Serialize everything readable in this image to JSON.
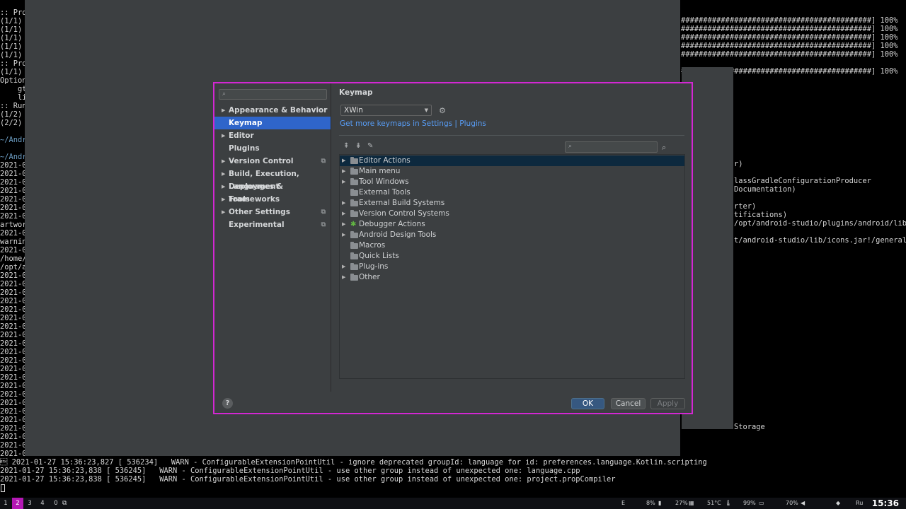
{
  "terminal_left": {
    "lines": [
      ":: Pro",
      "(1/1)",
      "(1/1)",
      "(1/1)",
      "(1/1)",
      "(1/1)",
      ":: Pro",
      "(1/1)",
      "Option",
      "    gt",
      "    li",
      ":: Run",
      "(1/2)",
      "(2/2)",
      "",
      "~/Andr",
      "",
      "~/Andr",
      "2021-0",
      "2021-0",
      "2021-0",
      "2021-0",
      "2021-0",
      "2021-0",
      "2021-0",
      "artwor",
      "2021-0",
      "warnin",
      "2021-0",
      "/home/",
      "/opt/a",
      "2021-0",
      "2021-0",
      "2021-0",
      "2021-0",
      "2021-0",
      "2021-0",
      "2021-0",
      "2021-0",
      "2021-0",
      "2021-0",
      "2021-0",
      "2021-0",
      "2021-0",
      "2021-0",
      "2021-0",
      "2021-0",
      "2021-0",
      "2021-0",
      "2021-0",
      "2021-0",
      "2021-0",
      "2021-0"
    ]
  },
  "terminal_right": {
    "lines": [
      "###########################################] 100%",
      "###########################################] 100%",
      "###########################################] 100%",
      "###########################################] 100%",
      "###########################################] 100%",
      "",
      "###########################################] 100%"
    ]
  },
  "terminal_right2": {
    "lines": [
      "r)",
      "",
      "lassGradleConfigurationProducer",
      "Documentation)",
      "",
      "rter)",
      "tifications)",
      "/opt/android-studio/plugins/android/lib/",
      "",
      "t/android-studio/lib/icons.jar!/general/",
      "",
      "",
      "",
      "",
      "",
      "",
      "",
      "",
      "",
      "",
      "",
      "",
      "",
      "",
      "",
      "",
      "",
      "",
      "",
      "",
      "",
      "Storage"
    ]
  },
  "terminal_bottom": {
    "lines": [
      "\u0003 2021-01-27 15:36:23,827 [ 536234]   WARN - ConfigurableExtensionPointUtil - ignore deprecated groupId: language for id: preferences.language.Kotlin.scripting",
      "2021-01-27 15:36:23,838 [ 536245]   WARN - ConfigurableExtensionPointUtil - use other group instead of unexpected one: language.cpp",
      "2021-01-27 15:36:23,838 [ 536245]   WARN - ConfigurableExtensionPointUtil - use other group instead of unexpected one: project.propCompiler"
    ]
  },
  "dialog": {
    "sidebar": {
      "search_placeholder": "Q-",
      "items": [
        {
          "label": "Appearance & Behavior"
        },
        {
          "label": "Keymap"
        },
        {
          "label": "Editor"
        },
        {
          "label": "Plugins"
        },
        {
          "label": "Version Control"
        },
        {
          "label": "Build, Execution, Deployment"
        },
        {
          "label": "Languages & Frameworks"
        },
        {
          "label": "Tools"
        },
        {
          "label": "Other Settings"
        },
        {
          "label": "Experimental"
        }
      ]
    },
    "main": {
      "title": "Keymap",
      "keymap_selected": "XWin",
      "get_more_link": "Get more keymaps in Settings | Plugins",
      "tree_search_placeholder": "Q-",
      "tree": [
        {
          "label": "Editor Actions"
        },
        {
          "label": "Main menu"
        },
        {
          "label": "Tool Windows"
        },
        {
          "label": "External Tools"
        },
        {
          "label": "External Build Systems"
        },
        {
          "label": "Version Control Systems"
        },
        {
          "label": "Debugger Actions"
        },
        {
          "label": "Android Design Tools"
        },
        {
          "label": "Macros"
        },
        {
          "label": "Quick Lists"
        },
        {
          "label": "Plug-ins"
        },
        {
          "label": "Other"
        }
      ]
    },
    "footer": {
      "help": "?",
      "ok": "OK",
      "cancel": "Cancel",
      "apply": "Apply"
    }
  },
  "taskbar": {
    "workspaces": [
      "1",
      "2",
      "3",
      "4",
      "0"
    ],
    "active_workspace": "2",
    "layout": "E",
    "cpu": "8%",
    "mem": "27%",
    "temp": "51°C",
    "battery": "99%",
    "volume": "70%",
    "lang": "Ru",
    "clock": "15:36"
  },
  "colors": {
    "dialog_border": "#d327d3",
    "selection": "#2f65ca",
    "link": "#589df6",
    "ok_button": "#365880",
    "active_workspace": "#b418b4"
  }
}
